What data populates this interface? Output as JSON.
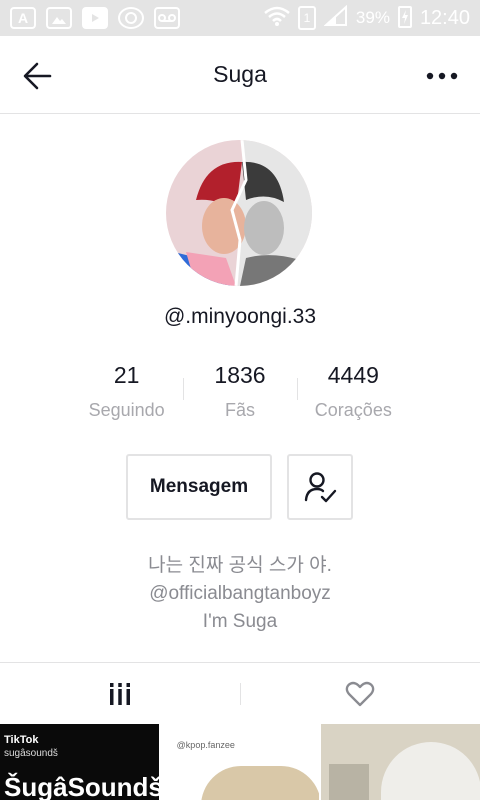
{
  "status_bar": {
    "battery": "39%",
    "time": "12:40",
    "sim": "1",
    "icons": [
      "app-store-icon",
      "image-icon",
      "youtube-icon",
      "whatsapp-icon",
      "voicemail-icon",
      "wifi-icon",
      "signal-icon",
      "charging-icon"
    ]
  },
  "header": {
    "title": "Suga",
    "back_icon": "arrow-left-icon",
    "more_icon": "more-dots-icon"
  },
  "profile": {
    "handle": "@.minyoongi.33",
    "stats": [
      {
        "value": "21",
        "label": "Seguindo"
      },
      {
        "value": "1836",
        "label": "Fãs"
      },
      {
        "value": "4449",
        "label": "Corações"
      }
    ],
    "message_label": "Mensagem",
    "follow_icon": "user-check-icon",
    "bio": [
      "나는 진짜 공식 스가 야.",
      "@officialbangtanboyz",
      "I'm Suga"
    ]
  },
  "tabs": [
    {
      "icon": "videos-grid-icon"
    },
    {
      "icon": "heart-icon"
    }
  ],
  "grid": {
    "tile1": {
      "watermark": "TikTok",
      "watermark_user": "sugâsoundš",
      "text": "ŠugâSoundš"
    },
    "tile2": {
      "watermark": "@kpop.fanzee"
    }
  },
  "colors": {
    "text": "#161823",
    "muted": "#a8a8ad",
    "border": "#e3e3e4",
    "status_bar": "#e4e4e4"
  }
}
